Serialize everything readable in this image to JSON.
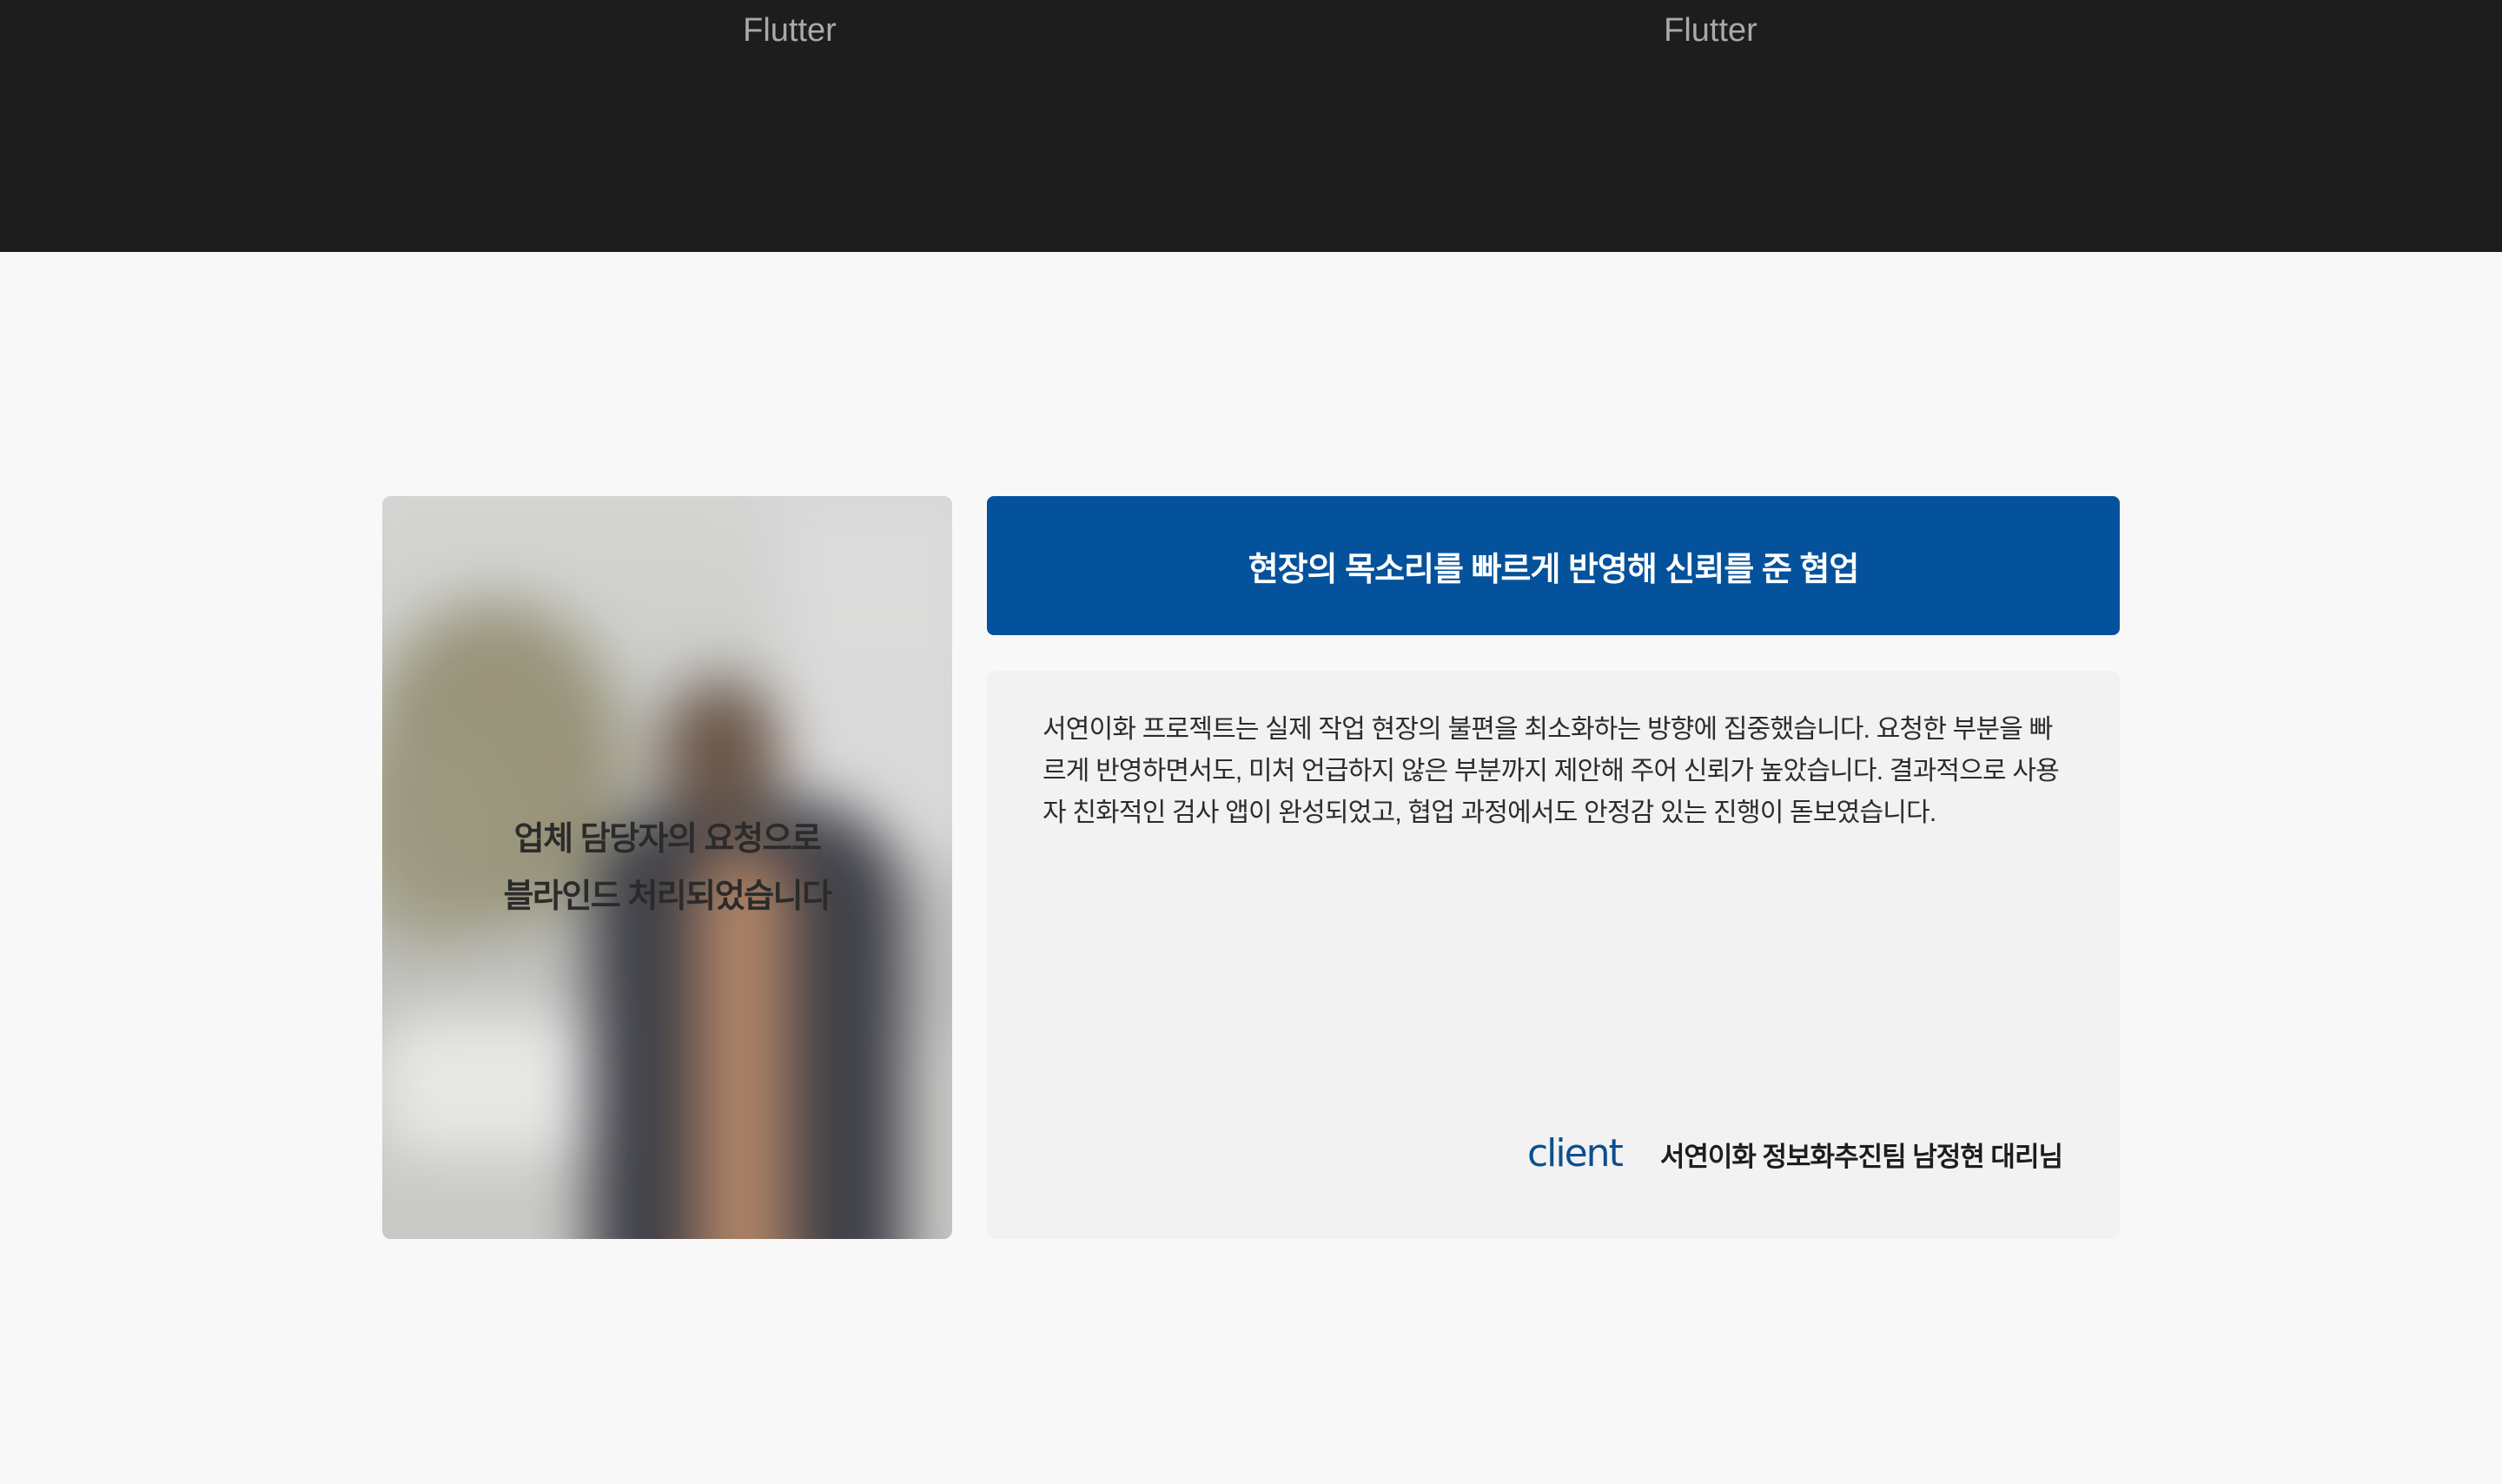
{
  "header": {
    "tech_left": "Flutter",
    "tech_right": "Flutter"
  },
  "photo": {
    "caption_line1": "업체 담당자의 요청으로",
    "caption_line2": "블라인드 처리되었습니다"
  },
  "testimonial": {
    "title": "현장의 목소리를 빠르게 반영해 신뢰를 준 협업",
    "body": "서연이화 프로젝트는 실제 작업 현장의 불편을 최소화하는 방향에 집중했습니다. 요청한 부분을 빠르게 반영하면서도, 미처 언급하지 않은 부분까지 제안해 주어 신뢰가 높았습니다. 결과적으로 사용자 친화적인 검사 앱이 완성되었고, 협업 과정에서도 안정감 있는 진행이 돋보였습니다.",
    "client_label": "client",
    "client_name": "서연이화 정보화추진팀 남정현 대리님"
  },
  "colors": {
    "top_band": "#1d1d1d",
    "accent": "#04529c",
    "page_bg": "#f8f8f8",
    "quote_bg": "#f2f2f2"
  }
}
